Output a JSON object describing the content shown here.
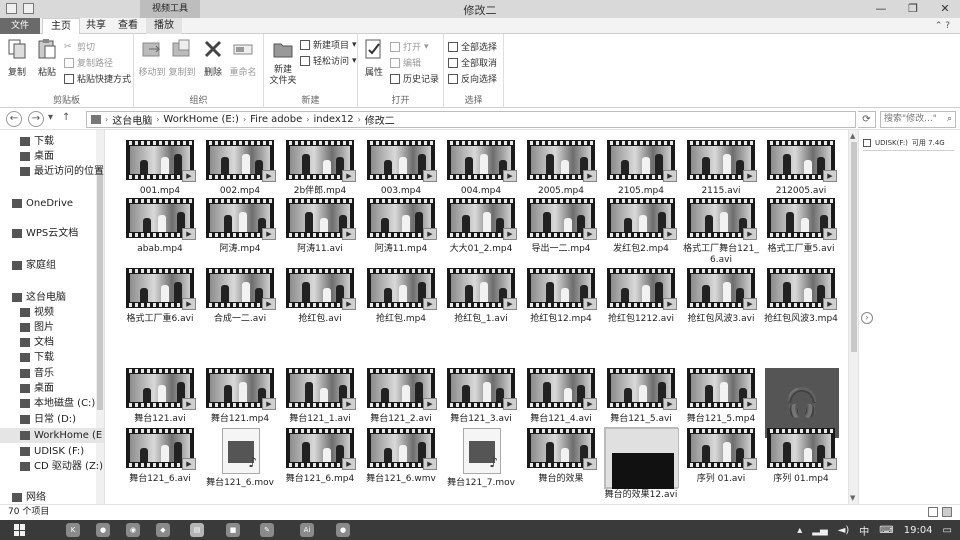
{
  "window": {
    "title": "修改二",
    "context_tab_title": "视频工具",
    "controls": [
      "minimize",
      "maximize",
      "close"
    ]
  },
  "tabs": [
    "文件",
    "主页",
    "共享",
    "查看",
    "播放"
  ],
  "ribbon": {
    "clipboard": {
      "label": "剪贴板",
      "copy": "复制",
      "paste": "粘贴",
      "cut": "剪切",
      "copy_path": "复制路径",
      "paste_shortcut": "粘贴快捷方式"
    },
    "organize": {
      "label": "组织",
      "move_to": "移动到",
      "copy_to": "复制到",
      "delete": "删除",
      "rename": "重命名"
    },
    "new": {
      "label": "新建",
      "new_folder": "新建\n文件夹",
      "new_item": "新建项目",
      "easy_access": "轻松访问"
    },
    "open": {
      "label": "打开",
      "properties": "属性",
      "open": "打开",
      "edit": "编辑",
      "history": "历史记录"
    },
    "select": {
      "label": "选择",
      "select_all": "全部选择",
      "select_none": "全部取消",
      "invert": "反向选择"
    }
  },
  "address": {
    "crumbs": [
      "这台电脑",
      "WorkHome (E:)",
      "Fire adobe",
      "index12",
      "修改二"
    ],
    "search_placeholder": "搜索\"修改...\""
  },
  "nav": [
    {
      "label": "下载",
      "indent": 1
    },
    {
      "label": "桌面",
      "indent": 1
    },
    {
      "label": "最近访问的位置",
      "indent": 1
    },
    {
      "label": "OneDrive",
      "indent": 0
    },
    {
      "label": "WPS云文档",
      "indent": 0
    },
    {
      "label": "家庭组",
      "indent": 0
    },
    {
      "label": "这台电脑",
      "indent": 0
    },
    {
      "label": "视频",
      "indent": 1
    },
    {
      "label": "图片",
      "indent": 1
    },
    {
      "label": "文档",
      "indent": 1
    },
    {
      "label": "下载",
      "indent": 1
    },
    {
      "label": "音乐",
      "indent": 1
    },
    {
      "label": "桌面",
      "indent": 1
    },
    {
      "label": "本地磁盘 (C:)",
      "indent": 1
    },
    {
      "label": "日常 (D:)",
      "indent": 1
    },
    {
      "label": "WorkHome (E",
      "indent": 1,
      "selected": true
    },
    {
      "label": "UDISK (F:)",
      "indent": 1
    },
    {
      "label": "CD 驱动器 (Z:)",
      "indent": 1
    },
    {
      "label": "网络",
      "indent": 0
    }
  ],
  "files": [
    {
      "name": "001.mp4",
      "kind": "video"
    },
    {
      "name": "002.mp4",
      "kind": "video"
    },
    {
      "name": "2b伴郎.mp4",
      "kind": "video"
    },
    {
      "name": "003.mp4",
      "kind": "video"
    },
    {
      "name": "004.mp4",
      "kind": "video"
    },
    {
      "name": "2005.mp4",
      "kind": "video"
    },
    {
      "name": "2105.mp4",
      "kind": "video"
    },
    {
      "name": "2115.avi",
      "kind": "video"
    },
    {
      "name": "212005.avi",
      "kind": "video"
    },
    {
      "name": "abab.mp4",
      "kind": "video"
    },
    {
      "name": "阿涛.mp4",
      "kind": "video"
    },
    {
      "name": "阿涛11.avi",
      "kind": "video"
    },
    {
      "name": "阿涛11.mp4",
      "kind": "video"
    },
    {
      "name": "大大01_2.mp4",
      "kind": "video"
    },
    {
      "name": "导出一二.mp4",
      "kind": "video"
    },
    {
      "name": "发红包2.mp4",
      "kind": "video"
    },
    {
      "name": "格式工厂舞台121_6.avi",
      "kind": "video"
    },
    {
      "name": "格式工厂重5.avi",
      "kind": "video"
    },
    {
      "name": "格式工厂重6.avi",
      "kind": "video"
    },
    {
      "name": "合成一二.avi",
      "kind": "video"
    },
    {
      "name": "抢红包.avi",
      "kind": "video"
    },
    {
      "name": "抢红包.mp4",
      "kind": "video"
    },
    {
      "name": "抢红包_1.avi",
      "kind": "video"
    },
    {
      "name": "抢红包12.mp4",
      "kind": "video"
    },
    {
      "name": "抢红包1212.avi",
      "kind": "video"
    },
    {
      "name": "抢红包风波3.avi",
      "kind": "video"
    },
    {
      "name": "抢红包风波3.mp4",
      "kind": "video"
    },
    {
      "name": "舞台121.avi",
      "kind": "video"
    },
    {
      "name": "舞台121.mp4",
      "kind": "video"
    },
    {
      "name": "舞台121_1.avi",
      "kind": "video"
    },
    {
      "name": "舞台121_2.avi",
      "kind": "video"
    },
    {
      "name": "舞台121_3.avi",
      "kind": "video"
    },
    {
      "name": "舞台121_4.avi",
      "kind": "video"
    },
    {
      "name": "舞台121_5.avi",
      "kind": "video"
    },
    {
      "name": "舞台121_5.mp4",
      "kind": "video"
    },
    {
      "name": "舞台121_5.wav",
      "kind": "audio"
    },
    {
      "name": "舞台121_6.avi",
      "kind": "video"
    },
    {
      "name": "舞台121_6.mov",
      "kind": "doc"
    },
    {
      "name": "舞台121_6.mp4",
      "kind": "video"
    },
    {
      "name": "舞台121_6.wmv",
      "kind": "video"
    },
    {
      "name": "舞台121_7.mov",
      "kind": "doc"
    },
    {
      "name": "舞台的效果",
      "kind": "video"
    },
    {
      "name": "舞台的效果12.avi",
      "kind": "black"
    },
    {
      "name": "序列 01.avi",
      "kind": "video"
    },
    {
      "name": "序列 01.mp4",
      "kind": "video"
    }
  ],
  "preview": {
    "drive": "UDISK(F:)",
    "free": "可用 7.4G"
  },
  "status": {
    "count": "70 个项目"
  },
  "taskbar": {
    "time": "19:04",
    "ime": "中"
  }
}
